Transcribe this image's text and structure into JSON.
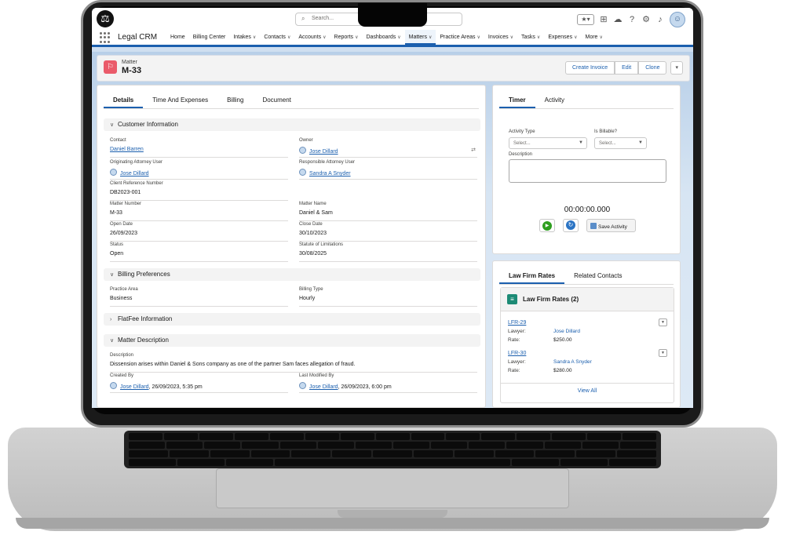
{
  "header": {
    "logo_icon": "scales-of-justice-icon",
    "search_placeholder": "Search..."
  },
  "nav": {
    "app_name": "Legal CRM",
    "items": [
      {
        "label": "Home",
        "chevron": false
      },
      {
        "label": "Billing Center",
        "chevron": false
      },
      {
        "label": "Intakes",
        "chevron": true
      },
      {
        "label": "Contacts",
        "chevron": true
      },
      {
        "label": "Accounts",
        "chevron": true
      },
      {
        "label": "Reports",
        "chevron": true
      },
      {
        "label": "Dashboards",
        "chevron": true
      },
      {
        "label": "Matters",
        "chevron": true,
        "active": true
      },
      {
        "label": "Practice Areas",
        "chevron": true
      },
      {
        "label": "Invoices",
        "chevron": true
      },
      {
        "label": "Tasks",
        "chevron": true
      },
      {
        "label": "Expenses",
        "chevron": true
      },
      {
        "label": "More",
        "chevron": true
      }
    ]
  },
  "record": {
    "object_label": "Matter",
    "title": "M-33",
    "actions": {
      "create_invoice": "Create Invoice",
      "edit": "Edit",
      "clone": "Clone"
    }
  },
  "detail_tabs": [
    "Details",
    "Time And Expenses",
    "Billing",
    "Document"
  ],
  "sections": {
    "customer": "Customer Information",
    "billing": "Billing Preferences",
    "flatfee": "FlatFee Information",
    "description": "Matter Description"
  },
  "fields": {
    "contact": {
      "label": "Contact",
      "value": "Daniel Barren"
    },
    "owner": {
      "label": "Owner",
      "value": "Jose Dillard"
    },
    "originating": {
      "label": "Originating Attorney User",
      "value": "Jose Dillard"
    },
    "responsible": {
      "label": "Responsible Attorney User",
      "value": "Sandra A Snyder"
    },
    "client_ref": {
      "label": "Client Reference Number",
      "value": "DB2023-001"
    },
    "matter_number": {
      "label": "Matter Number",
      "value": "M-33"
    },
    "matter_name": {
      "label": "Matter Name",
      "value": "Daniel & Sam"
    },
    "open_date": {
      "label": "Open Date",
      "value": "26/09/2023"
    },
    "close_date": {
      "label": "Close Date",
      "value": "30/10/2023"
    },
    "status": {
      "label": "Status",
      "value": "Open"
    },
    "statute": {
      "label": "Statute of Limitations",
      "value": "30/08/2025"
    },
    "practice_area": {
      "label": "Practice Area",
      "value": "Business"
    },
    "billing_type": {
      "label": "Billing Type",
      "value": "Hourly"
    },
    "description": {
      "label": "Description",
      "value": "Dissension arises within Daniel & Sons company as one of the partner Sam faces allegation of fraud."
    },
    "created_by": {
      "label": "Created By",
      "user": "Jose Dillard",
      "date": ", 26/09/2023, 5:35 pm"
    },
    "modified_by": {
      "label": "Last Modified By",
      "user": "Jose Dillard",
      "date": ", 26/09/2023, 6:00 pm"
    }
  },
  "timer": {
    "tabs": [
      "Timer",
      "Activity"
    ],
    "activity_type_label": "Activity Type",
    "activity_type_placeholder": "Select...",
    "billable_label": "Is Billable?",
    "billable_placeholder": "Select...",
    "description_label": "Description",
    "clock": "00:00:00.000",
    "save_label": "Save Activity"
  },
  "rates": {
    "tabs": [
      "Law Firm Rates",
      "Related Contacts"
    ],
    "list_title": "Law Firm Rates (2)",
    "lawyer_label": "Lawyer:",
    "rate_label": "Rate:",
    "items": [
      {
        "id": "LFR-29",
        "lawyer": "Jose Dillard",
        "rate": "$250.00"
      },
      {
        "id": "LFR-30",
        "lawyer": "Sandra A Snyder",
        "rate": "$280.00"
      }
    ],
    "view_all": "View All"
  }
}
